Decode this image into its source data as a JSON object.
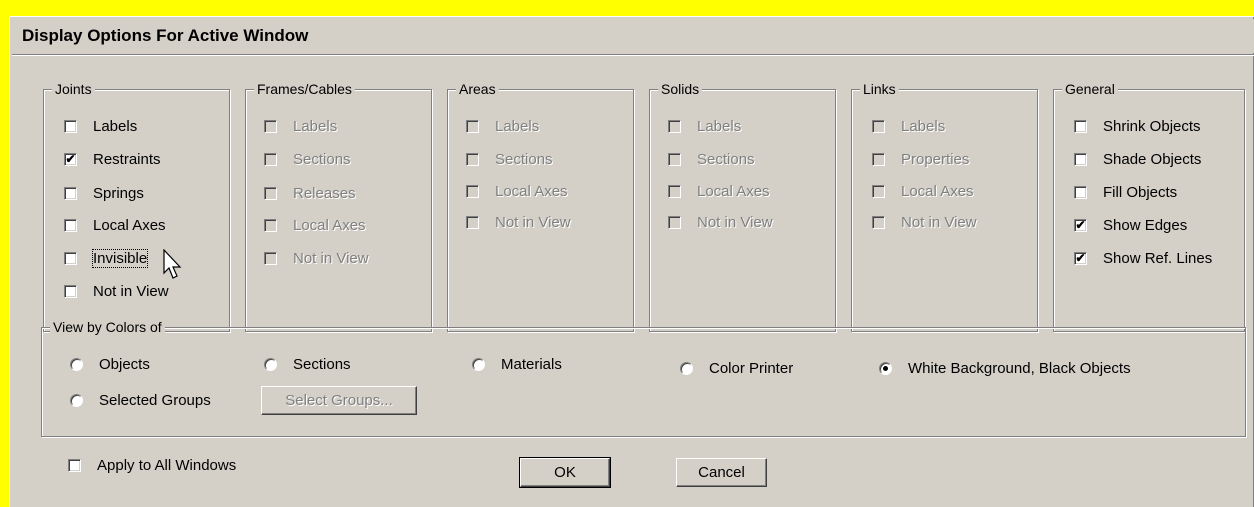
{
  "window": {
    "title": "Display Options For Active Window"
  },
  "groups": {
    "joints": {
      "label": "Joints",
      "items": [
        {
          "label": "Labels",
          "checked": false
        },
        {
          "label": "Restraints",
          "checked": true
        },
        {
          "label": "Springs",
          "checked": false
        },
        {
          "label": "Local Axes",
          "checked": false
        },
        {
          "label": "Invisible",
          "checked": false
        },
        {
          "label": "Not in View",
          "checked": false
        }
      ]
    },
    "frames": {
      "label": "Frames/Cables",
      "items": [
        {
          "label": "Labels"
        },
        {
          "label": "Sections"
        },
        {
          "label": "Releases"
        },
        {
          "label": "Local Axes"
        },
        {
          "label": "Not in View"
        }
      ]
    },
    "areas": {
      "label": "Areas",
      "items": [
        {
          "label": "Labels"
        },
        {
          "label": "Sections"
        },
        {
          "label": "Local Axes"
        },
        {
          "label": "Not in View"
        }
      ]
    },
    "solids": {
      "label": "Solids",
      "items": [
        {
          "label": "Labels"
        },
        {
          "label": "Sections"
        },
        {
          "label": "Local Axes"
        },
        {
          "label": "Not in View"
        }
      ]
    },
    "links": {
      "label": "Links",
      "items": [
        {
          "label": "Labels"
        },
        {
          "label": "Properties"
        },
        {
          "label": "Local Axes"
        },
        {
          "label": "Not in View"
        }
      ]
    },
    "general": {
      "label": "General",
      "items": [
        {
          "label": "Shrink Objects",
          "checked": false
        },
        {
          "label": "Shade Objects",
          "checked": false
        },
        {
          "label": "Fill Objects",
          "checked": false
        },
        {
          "label": "Show Edges",
          "checked": true
        },
        {
          "label": "Show Ref. Lines",
          "checked": true
        }
      ]
    }
  },
  "view_by_colors": {
    "label": "View by Colors of",
    "options": [
      {
        "label": "Objects",
        "selected": false
      },
      {
        "label": "Sections",
        "selected": false
      },
      {
        "label": "Materials",
        "selected": false
      },
      {
        "label": "Color Printer",
        "selected": false
      },
      {
        "label": "White Background, Black Objects",
        "selected": true
      },
      {
        "label": "Selected Groups",
        "selected": false
      }
    ],
    "select_groups_button": "Select Groups..."
  },
  "apply_all": {
    "label": "Apply to All Windows",
    "checked": false
  },
  "buttons": {
    "ok": "OK",
    "cancel": "Cancel"
  },
  "check_mark": "✔",
  "colors": {
    "desktop": "#ffff00",
    "face": "#d4d0c8",
    "disabled_text": "#808080"
  }
}
